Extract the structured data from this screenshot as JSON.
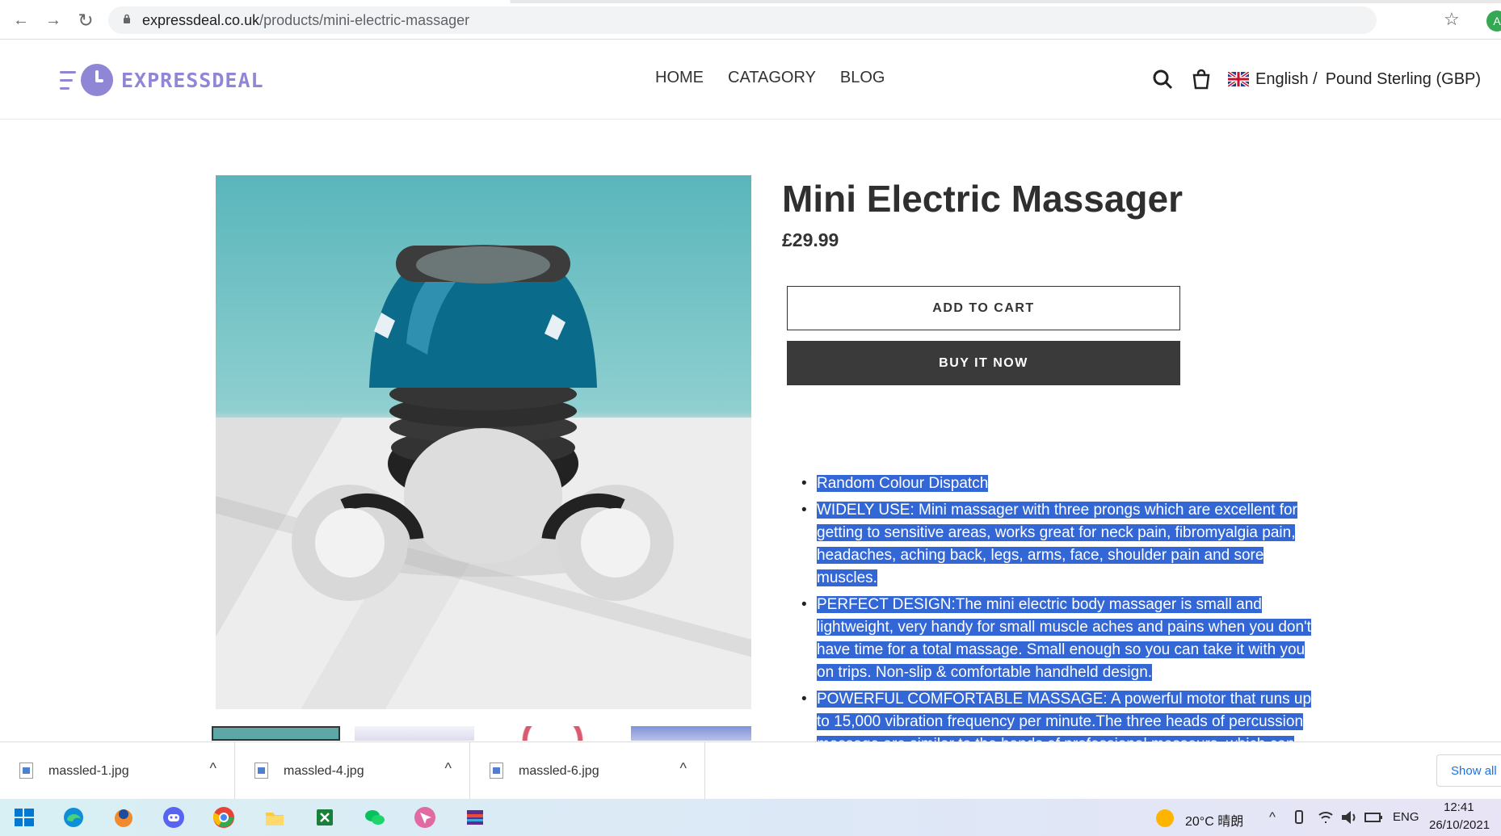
{
  "browser": {
    "url_domain": "expressdeal.co.uk",
    "url_path": "/products/mini-electric-massager",
    "back": "←",
    "forward": "→",
    "reload": "↻",
    "bookmark": "☆",
    "profile_initial": "A"
  },
  "store": {
    "logo_text": "EXPRESSDEAL",
    "nav": [
      "HOME",
      "CATAGORY",
      "BLOG"
    ],
    "language": "English /",
    "currency": "Pound Sterling (GBP)"
  },
  "product": {
    "title": "Mini Electric Massager",
    "price": "£29.99",
    "add_to_cart": "ADD TO CART",
    "buy_now": "BUY IT NOW",
    "description": [
      "Random Colour Dispatch ",
      "WIDELY USE: Mini massager with three prongs which are excellent for getting to sensitive areas, works great for neck pain, fibromyalgia pain, headaches, aching back, legs, arms, face, shoulder pain and sore muscles.",
      "PERFECT DESIGN:The mini electric body massager is small and lightweight, very handy for small muscle aches and pains when you don't have time for a total massage. Small enough so you can take it with you on trips. Non-slip & comfortable handheld design.",
      "POWERFUL COMFORTABLE MASSAGE: A powerful motor that runs up to 15,000 vibration frequency per minute.The three heads of percussion massage are similar to the hands of professional masseurs, which can"
    ]
  },
  "downloads": {
    "files": [
      "massled-1.jpg",
      "massled-4.jpg",
      "massled-6.jpg"
    ],
    "caret": "^",
    "show_all": "Show all"
  },
  "taskbar": {
    "weather": "20°C 晴朗",
    "chevron": "^",
    "language": "ENG",
    "time": "12:41",
    "date": "26/10/2021"
  },
  "colors": {
    "logo": "#8f86d6",
    "selection": "#3367d6",
    "buy_button": "#3a3a3a"
  }
}
